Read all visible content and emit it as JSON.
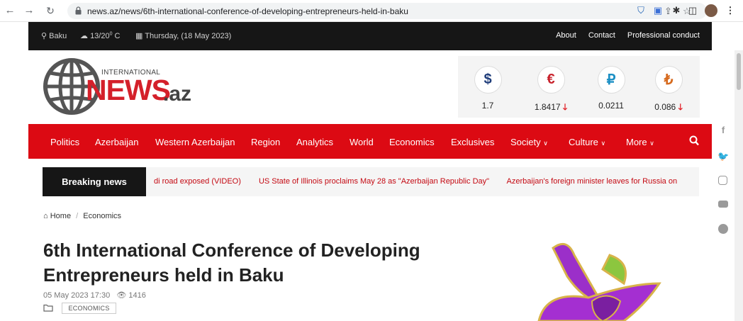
{
  "browser": {
    "url": "news.az/news/6th-international-conference-of-developing-entrepreneurs-held-in-baku"
  },
  "topbar": {
    "city": "Baku",
    "weather": "13/20",
    "weather_sup": "0",
    "weather_unit": " C",
    "date": "Thursday, (18 May 2023)",
    "links": [
      "About",
      "Contact",
      "Professional conduct"
    ]
  },
  "logo": {
    "international": "INTERNATIONAL",
    "news": "NEWS",
    "az": ".az"
  },
  "currency": [
    {
      "symbol": "$",
      "value": "1.7",
      "color": "#1f3d7a",
      "down": false
    },
    {
      "symbol": "€",
      "value": "1.8417",
      "color": "#c8222c",
      "down": true
    },
    {
      "symbol": "₽",
      "value": "0.0211",
      "color": "#1b8fc4",
      "down": false
    },
    {
      "symbol": "₺",
      "value": "0.086",
      "color": "#d66a1e",
      "down": true
    }
  ],
  "nav": {
    "items": [
      "Politics",
      "Azerbaijan",
      "Western Azerbaijan",
      "Region",
      "Analytics",
      "World",
      "Economics",
      "Exclusives"
    ],
    "dropdowns": [
      "Society",
      "Culture",
      "More"
    ]
  },
  "breaking": {
    "label": "Breaking news",
    "items": [
      "di road exposed (VIDEO)",
      "US State of Illinois proclaims May 28 as \"Azerbaijan Republic Day\"",
      "Azerbaijan's foreign minister leaves for Russia on"
    ]
  },
  "breadcrumb": {
    "home": "Home",
    "section": "Economics"
  },
  "article": {
    "title_line1": "6th International Conference of Developing",
    "title_line2": "Entrepreneurs held in Baku",
    "datetime": "05 May 2023 17:30",
    "views": "1416",
    "category": "ECONOMICS"
  },
  "colors": {
    "brand_red": "#dc0a13",
    "dark": "#161616"
  }
}
